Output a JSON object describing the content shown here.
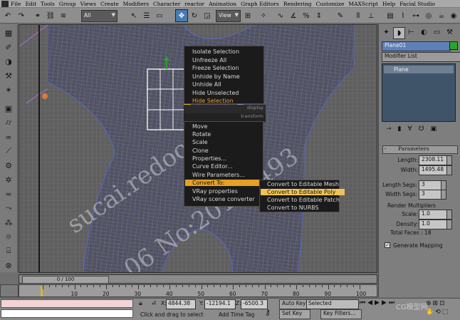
{
  "menubar": {
    "items": [
      "File",
      "Edit",
      "Tools",
      "Group",
      "Views",
      "Create",
      "Modifiers",
      "Character",
      "reactor",
      "Animation",
      "Graph Editors",
      "Rendering",
      "Customize",
      "MAXScript",
      "Help",
      "Facial Studio"
    ]
  },
  "toolbar": {
    "selection_filter": "All",
    "reference_coord": "View"
  },
  "quad_menu": {
    "display_items": [
      "Isolate Selection",
      "Unfreeze All",
      "Freeze Selection",
      "Unhide by Name",
      "Unhide All",
      "Hide Unselected",
      "Hide Selection"
    ],
    "display_label": "display",
    "transform_label": "transform",
    "transform_items": [
      "Move",
      "Rotate",
      "Scale",
      "Clone",
      "Properties...",
      "Curve Editor...",
      "Wire Parameters...",
      "Convert To:",
      "VRay properties",
      "VRay scene converter"
    ],
    "convert_submenu": [
      "Convert to Editable Mesh",
      "Convert to Editable Poly",
      "Convert to Editable Patch",
      "Convert to NURBS"
    ]
  },
  "timeline": {
    "frame_display": "0 / 100",
    "ticks": [
      "10",
      "20",
      "30",
      "40",
      "50",
      "60",
      "70",
      "80",
      "90",
      "100"
    ]
  },
  "status": {
    "x_label": "X:",
    "x_value": "4844.38",
    "y_label": "Y:",
    "y_value": "-12194.1",
    "z_label": "Z:",
    "z_value": "-6500.3",
    "prompt": "Click and drag to select",
    "add_time_tag": "Add Time Tag",
    "auto_key": "Auto Key",
    "selected_dropdown": "Selected",
    "set_key": "Set Key",
    "key_filters": "Key Filters..."
  },
  "command_panel": {
    "object_name": "Plane01",
    "modifier_list": "Modifier List",
    "stack_item": "Plane",
    "params_title": "Parameters",
    "length_label": "Length:",
    "length_value": "2308.11",
    "width_label": "Width:",
    "width_value": "1495.48",
    "length_segs_label": "Length Segs:",
    "length_segs_value": "3",
    "width_segs_label": "Width Segs:",
    "width_segs_value": "3",
    "render_mult_title": "Render Multipliers",
    "scale_label": "Scale:",
    "scale_value": "1.0",
    "density_label": "Density:",
    "density_value": "1.0",
    "total_faces": "Total Faces : 18",
    "generate_mapping": "Generate Mapping"
  },
  "watermarks": {
    "site": "sucai.redocn.com",
    "id": "06 No:20116493",
    "corner": "CG模型网"
  },
  "colors": {
    "menu_highlight": "#e6a024",
    "submenu_highlight": "#f0c35a",
    "selection_orange": "#e8a338",
    "object_color": "#2aa52a"
  }
}
